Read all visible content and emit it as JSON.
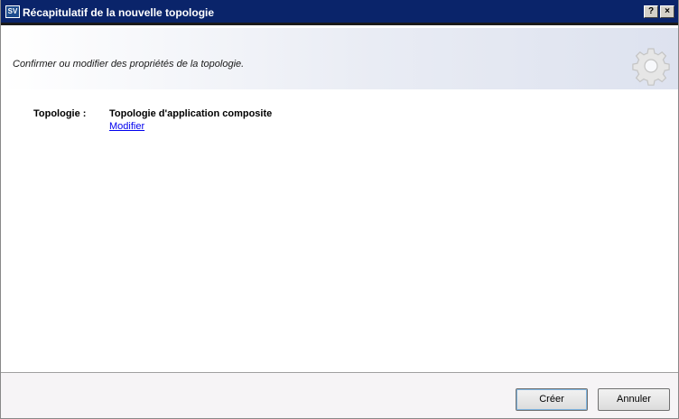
{
  "window": {
    "title": "Récapitulatif de la nouvelle topologie",
    "app_icon_text": "SV",
    "help_label": "?",
    "close_label": "×"
  },
  "header": {
    "subtitle": "Confirmer ou modifier des propriétés de la topologie.",
    "icon": "gear-icon"
  },
  "properties": {
    "label": "Topologie :",
    "value": "Topologie d'application composite",
    "link": "Modifier"
  },
  "footer": {
    "create_label": "Créer",
    "cancel_label": "Annuler"
  },
  "colors": {
    "titlebar": "#0a246a",
    "link": "#0000ee",
    "footer": "#f6f4f6"
  }
}
